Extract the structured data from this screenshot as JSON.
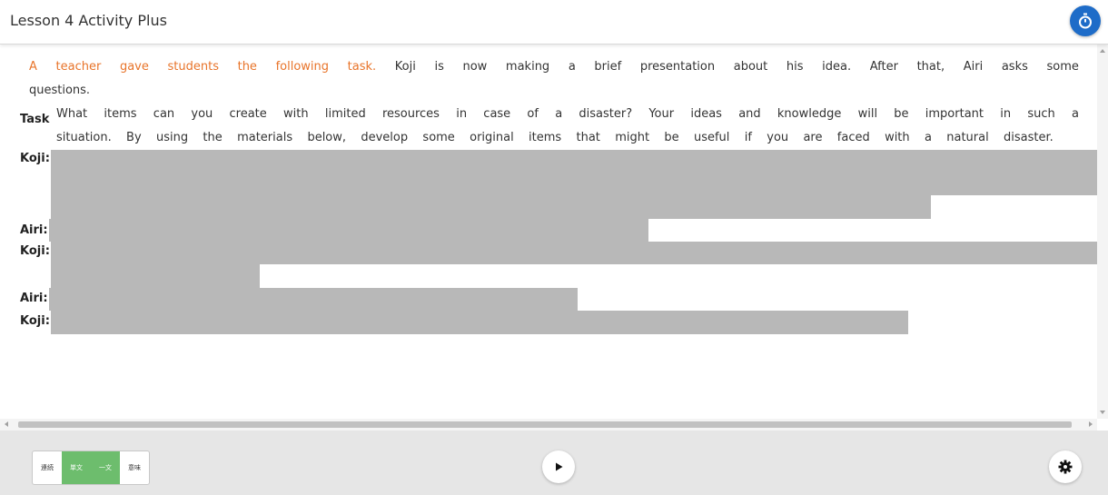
{
  "header": {
    "title": "Lesson 4 Activity Plus",
    "timer_icon": "stopwatch-icon",
    "accent_color": "#1e6cc8"
  },
  "intro": {
    "line1_orange": [
      "A",
      "teacher",
      "gave",
      "students",
      "the",
      "following",
      "task."
    ],
    "line1_dark": [
      "Koji",
      "is",
      "now",
      "making",
      "a",
      "brief",
      "presentation",
      "about",
      "his",
      "idea.",
      "After",
      "that,",
      "Airi",
      "asks",
      "some"
    ],
    "line2": "questions.",
    "color": "#e8742a"
  },
  "task": {
    "label": "Task",
    "line1": [
      "What",
      "items",
      "can",
      "you",
      "create",
      "with",
      "limited",
      "resources",
      "in",
      "case",
      "of",
      "a",
      "disaster?",
      "Your",
      "ideas",
      "and",
      "knowledge",
      "will",
      "be",
      "important",
      "in",
      "such",
      "a"
    ],
    "line2": [
      "situation.",
      "By",
      "using",
      "the",
      "materials",
      "below,",
      "develop",
      "some",
      "original",
      "items",
      "that",
      "might",
      "be",
      "useful",
      "if",
      "you",
      "are",
      "faced",
      "with",
      "a",
      "natural",
      "disaster."
    ]
  },
  "dialogue": [
    {
      "speaker": "Koji:"
    },
    {
      "speaker": "Airi:"
    },
    {
      "speaker": "Koji:"
    },
    {
      "speaker": "Airi:"
    },
    {
      "speaker": "Koji:"
    }
  ],
  "footer": {
    "modes": [
      {
        "label": "連続",
        "active": false
      },
      {
        "label": "単文",
        "active": true
      },
      {
        "label": "一文",
        "active": true
      },
      {
        "label": "意味",
        "active": false
      }
    ],
    "play_icon": "play-icon",
    "settings_icon": "gear-icon",
    "active_color": "#6dbd6d"
  }
}
